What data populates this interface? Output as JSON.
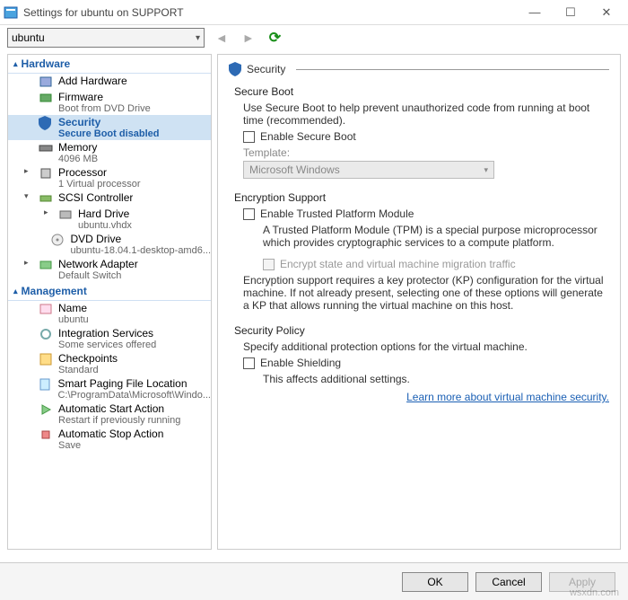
{
  "window": {
    "title": "Settings for ubuntu on SUPPORT"
  },
  "toolbar": {
    "vm_name": "ubuntu",
    "nav_prev": "◄",
    "nav_next": "►",
    "refresh": "⟳"
  },
  "sidebar": {
    "groups": {
      "hardware": "Hardware",
      "management": "Management"
    },
    "items": [
      {
        "label": "Add Hardware",
        "subtext": ""
      },
      {
        "label": "Firmware",
        "subtext": "Boot from DVD Drive"
      },
      {
        "label": "Security",
        "subtext": "Secure Boot disabled",
        "selected": true
      },
      {
        "label": "Memory",
        "subtext": "4096 MB"
      },
      {
        "label": "Processor",
        "subtext": "1 Virtual processor"
      },
      {
        "label": "SCSI Controller",
        "subtext": ""
      },
      {
        "label": "Hard Drive",
        "subtext": "ubuntu.vhdx"
      },
      {
        "label": "DVD Drive",
        "subtext": "ubuntu-18.04.1-desktop-amd6..."
      },
      {
        "label": "Network Adapter",
        "subtext": "Default Switch"
      },
      {
        "label": "Name",
        "subtext": "ubuntu"
      },
      {
        "label": "Integration Services",
        "subtext": "Some services offered"
      },
      {
        "label": "Checkpoints",
        "subtext": "Standard"
      },
      {
        "label": "Smart Paging File Location",
        "subtext": "C:\\ProgramData\\Microsoft\\Windo..."
      },
      {
        "label": "Automatic Start Action",
        "subtext": "Restart if previously running"
      },
      {
        "label": "Automatic Stop Action",
        "subtext": "Save"
      }
    ]
  },
  "pane": {
    "header": "Security",
    "secure_boot": {
      "title": "Secure Boot",
      "desc": "Use Secure Boot to help prevent unauthorized code from running at boot time (recommended).",
      "checkbox": "Enable Secure Boot",
      "template_label": "Template:",
      "template_value": "Microsoft Windows"
    },
    "encryption": {
      "title": "Encryption Support",
      "checkbox": "Enable Trusted Platform Module",
      "tpm_desc": "A Trusted Platform Module (TPM) is a special purpose microprocessor which provides cryptographic services to a compute platform.",
      "encrypt_state_checkbox": "Encrypt state and virtual machine migration traffic",
      "note": "Encryption support requires a key protector (KP) configuration for the virtual machine. If not already present, selecting one of these options will generate a KP that allows running the virtual machine on this host."
    },
    "policy": {
      "title": "Security Policy",
      "desc": "Specify additional protection options for the virtual machine.",
      "checkbox": "Enable Shielding",
      "affects": "This affects additional settings.",
      "link": "Learn more about virtual machine security."
    }
  },
  "footer": {
    "ok": "OK",
    "cancel": "Cancel",
    "apply": "Apply"
  },
  "watermark": "wsxdn.com"
}
